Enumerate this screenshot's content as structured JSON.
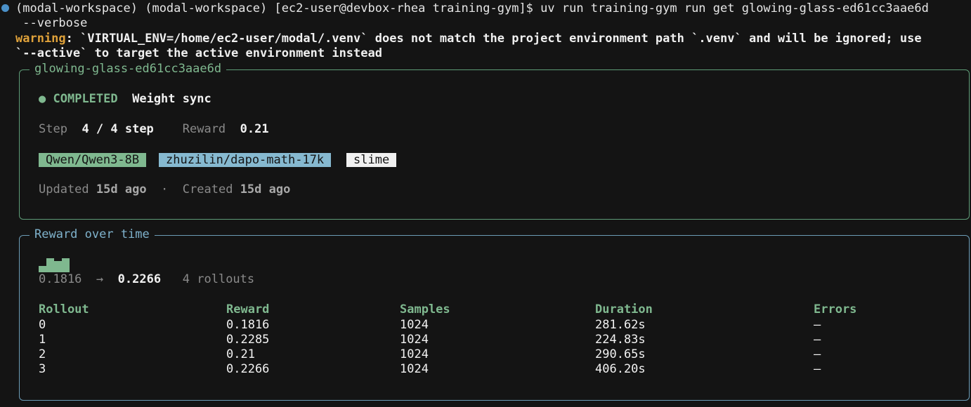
{
  "terminal": {
    "prompt_line": "(modal-workspace) (modal-workspace) [ec2-user@devbox-rhea training-gym]$ uv run training-gym run get glowing-glass-ed61cc3aae6d",
    "prompt_cont": " --verbose",
    "warning_label": "warning",
    "warning_text_1": ": `VIRTUAL_ENV=/home/ec2-user/modal/.venv` does not match the project environment path `.venv` and will be ignored; use",
    "warning_text_2": "`--active` to target the active environment instead"
  },
  "run_panel": {
    "title": "glowing-glass-ed61cc3aae6d",
    "status_dot": "●",
    "status": "COMPLETED",
    "phase": "Weight sync",
    "step_label": "Step",
    "step_value": "4 / 4 step",
    "reward_label": "Reward",
    "reward_value": "0.21",
    "tags": {
      "model": "Qwen/Qwen3-8B",
      "dataset": "zhuzilin/dapo-math-17k",
      "framework": "slime"
    },
    "updated_label": "Updated",
    "updated_value": "15d ago",
    "separator": "·",
    "created_label": "Created",
    "created_value": "15d ago"
  },
  "reward_panel": {
    "title": "Reward over time",
    "sparkline": [
      0.1816,
      0.2285,
      0.21,
      0.2266
    ],
    "start_value": "0.1816",
    "arrow": "→",
    "end_value": "0.2266",
    "rollouts_text": "4 rollouts",
    "columns": [
      "Rollout",
      "Reward",
      "Samples",
      "Duration",
      "Errors"
    ],
    "rows": [
      [
        "0",
        "0.1816",
        "1024",
        "281.62s",
        "–"
      ],
      [
        "1",
        "0.2285",
        "1024",
        "224.83s",
        "–"
      ],
      [
        "2",
        "0.21",
        "1024",
        "290.65s",
        "–"
      ],
      [
        "3",
        "0.2266",
        "1024",
        "406.20s",
        "–"
      ]
    ]
  },
  "colors": {
    "background": "#141414",
    "green": "#7fb88f",
    "blue": "#86b9d0",
    "warning": "#e0a23a",
    "prompt_dot": "#4a90c8"
  }
}
